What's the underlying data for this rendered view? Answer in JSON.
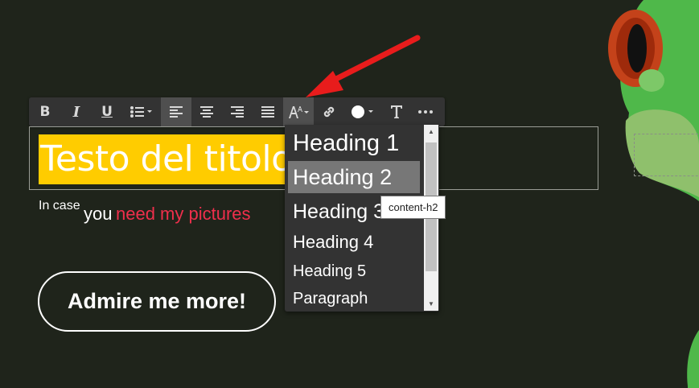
{
  "toolbar": {
    "buttons": [
      {
        "name": "bold-icon",
        "glyph": "B"
      },
      {
        "name": "italic-icon",
        "glyph": "I"
      },
      {
        "name": "underline-icon",
        "glyph": "U"
      },
      {
        "name": "list-icon"
      },
      {
        "name": "align-left-icon",
        "active": true
      },
      {
        "name": "align-center-icon"
      },
      {
        "name": "align-right-icon"
      },
      {
        "name": "align-justify-icon"
      },
      {
        "name": "text-size-icon"
      },
      {
        "name": "link-icon"
      },
      {
        "name": "color-icon"
      },
      {
        "name": "text-style-icon"
      },
      {
        "name": "more-icon"
      }
    ]
  },
  "title": {
    "text": "Testo del titolo",
    "highlight_color": "#ffcc00"
  },
  "subline": {
    "small": "In case",
    "you": "you",
    "link": "need my pictures",
    "link_color": "#ef2f4c"
  },
  "cta": {
    "label": "Admire me more!"
  },
  "dropdown": {
    "items": [
      {
        "label": "Heading 1",
        "selected": false
      },
      {
        "label": "Heading 2",
        "selected": true
      },
      {
        "label": "Heading 3",
        "selected": false
      },
      {
        "label": "Heading 4",
        "selected": false
      },
      {
        "label": "Heading 5",
        "selected": false
      },
      {
        "label": "Paragraph",
        "selected": false
      }
    ]
  },
  "tooltip": {
    "text": "content-h2"
  },
  "colors": {
    "background": "#1f241b",
    "toolbar": "#333333",
    "annotation_arrow": "#e81c1c"
  }
}
